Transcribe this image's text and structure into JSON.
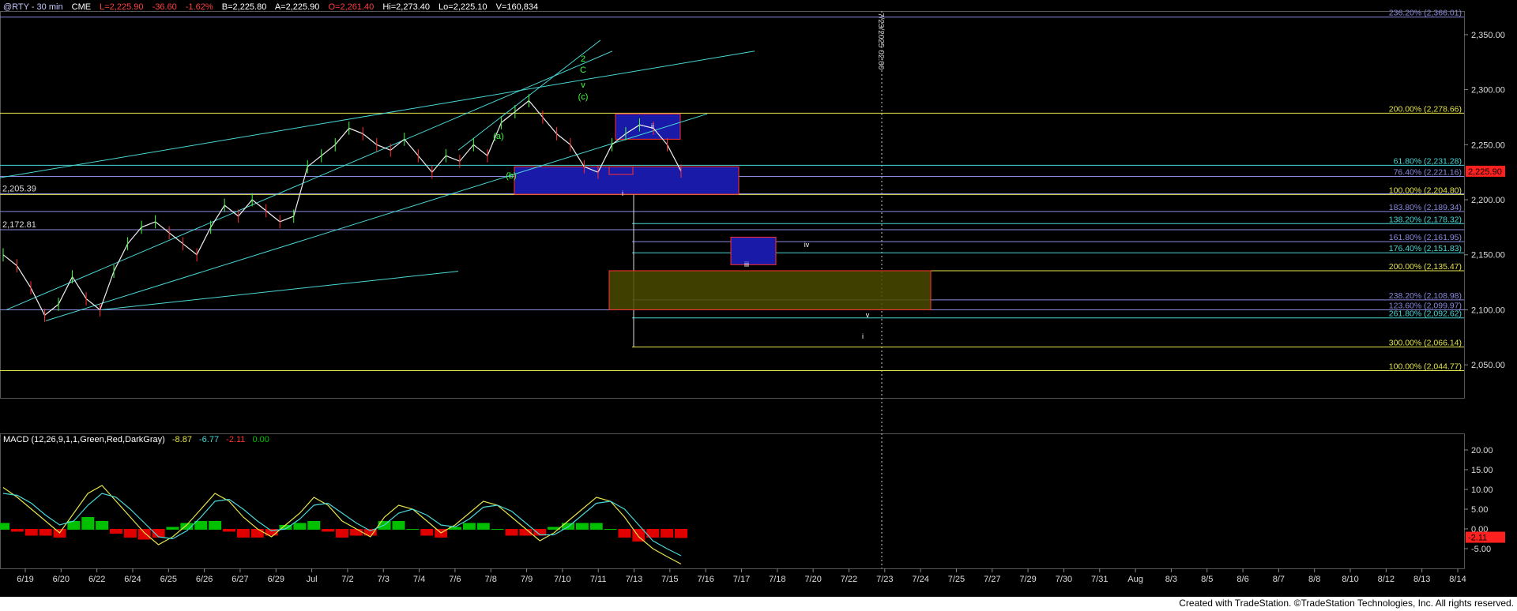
{
  "header": {
    "symbol": "@RTY - 30 min",
    "exchange": "CME",
    "last": "L=2,225.90",
    "change": "-36.60",
    "change_pct": "-1.62%",
    "bid": "B=2,225.80",
    "ask": "A=2,225.90",
    "open": "O=2,261.40",
    "high": "Hi=2,273.40",
    "low": "Lo=2,225.10",
    "volume": "V=160,834"
  },
  "vertical_line_label": "7/23/2025 02:00",
  "colors": {
    "up": "#ffffff",
    "accent_green": "#00ff00",
    "red": "#ff2020",
    "cyan": "#4ad7d7",
    "yellow": "#e5e54b",
    "blue_box": "#1a1aa8",
    "olive_box": "#4a4a00"
  },
  "price_axis": {
    "min": 2020,
    "max": 2370,
    "ticks": [
      "2,350.00",
      "2,300.00",
      "2,250.00",
      "2,200.00",
      "2,150.00",
      "2,100.00",
      "2,050.00"
    ],
    "tick_values": [
      2350,
      2300,
      2250,
      2200,
      2150,
      2100,
      2050
    ],
    "current_price": "2,225.90"
  },
  "macd_axis": {
    "min": -10,
    "max": 22,
    "ticks": [
      "20.00",
      "15.00",
      "10.00",
      "5.00",
      "0.00",
      "-5.00"
    ],
    "tick_values": [
      20,
      15,
      10,
      5,
      0,
      -5
    ],
    "current_label": "-2.11"
  },
  "macd_header": {
    "title": "MACD (12,26,9,1,1,Green,Red,DarkGray)",
    "macd": "-8.87",
    "signal": "-6.77",
    "hist": "-2.11",
    "zero": "0.00"
  },
  "date_axis": [
    "6/19",
    "6/20",
    "6/22",
    "6/24",
    "6/25",
    "6/26",
    "6/27",
    "6/29",
    "Jul",
    "7/2",
    "7/3",
    "7/4",
    "7/6",
    "7/8",
    "7/9",
    "7/10",
    "7/11",
    "7/13",
    "7/15",
    "7/16",
    "7/17",
    "7/18",
    "7/20",
    "7/22",
    "7/23",
    "7/24",
    "7/25",
    "7/27",
    "7/29",
    "7/30",
    "7/31",
    "Aug",
    "8/3",
    "8/5",
    "8/6",
    "8/7",
    "8/8",
    "8/10",
    "8/12",
    "8/13",
    "8/14"
  ],
  "left_labels": [
    "2,205.39",
    "2,172.81"
  ],
  "fib_labels": [
    {
      "text": "236.20% (2,366.01)",
      "price": 2366.01,
      "color": "#8a8ae0"
    },
    {
      "text": "200.00% (2,278.66)",
      "price": 2278.66,
      "color": "#e5e54b"
    },
    {
      "text": "61.80% (2,231.28)",
      "price": 2231.28,
      "color": "#4ad7d7"
    },
    {
      "text": "76.40% (2,221.16)",
      "price": 2221.16,
      "color": "#8a8ae0"
    },
    {
      "text": "100.00% (2,204.80)",
      "price": 2204.8,
      "color": "#e5e54b"
    },
    {
      "text": "183.80% (2,189.34)",
      "price": 2189.34,
      "color": "#8a8ae0"
    },
    {
      "text": "138.20% (2,178.32)",
      "price": 2178.32,
      "color": "#4ad7d7"
    },
    {
      "text": "161.80% (2,161.95)",
      "price": 2161.95,
      "color": "#8a8ae0"
    },
    {
      "text": "176.40% (2,151.83)",
      "price": 2151.83,
      "color": "#4ad7d7"
    },
    {
      "text": "200.00% (2,135.47)",
      "price": 2135.47,
      "color": "#e5e54b"
    },
    {
      "text": "238.20% (2,108.98)",
      "price": 2108.98,
      "color": "#8a8ae0"
    },
    {
      "text": "123.60% (2,099.97)",
      "price": 2099.97,
      "color": "#8a8ae0"
    },
    {
      "text": "261.80% (2,092.62)",
      "price": 2092.62,
      "color": "#4ad7d7"
    },
    {
      "text": "300.00% (2,066.14)",
      "price": 2066.14,
      "color": "#e5e54b"
    },
    {
      "text": "100.00% (2,044.77)",
      "price": 2044.77,
      "color": "#e5e54b"
    }
  ],
  "wave_labels": {
    "green": [
      "2",
      "C",
      "v",
      "(c)",
      "(a)",
      "(b)"
    ],
    "white": [
      "i",
      "ii",
      "iii",
      "iv",
      "v",
      "i"
    ]
  },
  "chart_data": {
    "type": "line",
    "title": "",
    "series": [
      {
        "values": [
          2150,
          2140,
          2120,
          2095,
          2105,
          2130,
          2110,
          2100,
          2135,
          2160,
          2175,
          2180,
          2170,
          2160,
          2150,
          2175,
          2195,
          2185,
          2200,
          2190,
          2180,
          2185,
          2230,
          2240,
          2250,
          2265,
          2260,
          2250,
          2245,
          2255,
          2240,
          2225,
          2240,
          2235,
          2250,
          2240,
          2270,
          2280,
          2290,
          2275,
          2260,
          2250,
          2230,
          2225,
          2250,
          2260,
          2268,
          2265,
          2250,
          2226
        ]
      },
      {
        "values": [
          10.5,
          8,
          5,
          2,
          -1,
          4,
          9,
          11,
          7,
          3,
          -1,
          -4,
          -2,
          1,
          5,
          9,
          7,
          3,
          0,
          -2,
          1,
          4,
          8,
          6,
          2,
          0,
          -2,
          3,
          6,
          5,
          2,
          -1,
          1,
          4,
          7,
          6,
          3,
          0,
          -3,
          -1,
          2,
          5,
          8,
          7,
          3,
          -2,
          -5,
          -7,
          -8.9
        ]
      },
      {
        "values": [
          9,
          8.5,
          6.5,
          3.5,
          1,
          2,
          6,
          9,
          8,
          5,
          1.5,
          -2,
          -2.5,
          -0.5,
          3,
          7,
          7.5,
          5,
          2,
          -0.5,
          0,
          2.5,
          6,
          6.5,
          4,
          1.5,
          -0.5,
          1,
          4,
          5,
          3.5,
          1,
          0.5,
          2.5,
          5.5,
          6,
          4.5,
          1.5,
          -1.5,
          -1.5,
          0.5,
          3.5,
          6.5,
          7,
          5,
          1,
          -3,
          -5,
          -6.8
        ]
      }
    ]
  },
  "footer": "Created with TradeStation. ©TradeStation Technologies, Inc. All rights reserved."
}
